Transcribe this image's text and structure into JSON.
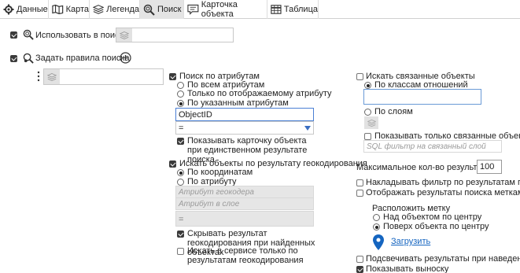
{
  "tabs": [
    {
      "label": "Данные",
      "icon": "gear-icon"
    },
    {
      "label": "Карта",
      "icon": "map-icon"
    },
    {
      "label": "Легенда",
      "icon": "layers-icon"
    },
    {
      "label": "Поиск",
      "icon": "search-icon",
      "active": true
    },
    {
      "label": "Карточка объекта",
      "icon": "card-icon"
    },
    {
      "label": "Таблица",
      "icon": "table-icon"
    }
  ],
  "use_in_search": "Использовать в поиске",
  "set_rules": "Задать правила поиска",
  "attr": {
    "title": "Поиск по атрибутам",
    "all": "По всем атрибутам",
    "display_only": "Только по отображаемому атрибуту",
    "specified": "По указанным атрибутам",
    "attribute_value": "ObjectID",
    "operator": "=",
    "show_card": "Показывать карточку объекта при единственном результате поиска"
  },
  "geo": {
    "title": "Искать объекты по результату геокодирования",
    "by_coords": "По координатам",
    "by_attr": "По атрибуту",
    "geocoder_placeholder": "Атрибут геокодера",
    "layer_placeholder": "Атрибут в слое",
    "operator": "=",
    "hide_result": "Скрывать результат геокодирования при найденных объектах",
    "search_service": "Искать в сервисе только по результатам геокодирования"
  },
  "related": {
    "title": "Искать связанные объекты",
    "by_classes": "По классам отношений",
    "by_layers": "По слоям",
    "show_only": "Показывать только связанные объекты",
    "sql_placeholder": "SQL фильтр на связанный слой"
  },
  "max_label": "Максимальное кол-во результатов",
  "max_value": "100",
  "apply_filter": "Накладывать фильтр по результатам поиска",
  "show_marks": "Отображать результаты поиска метками",
  "place_mark": "Расположить метку",
  "above": "Над объектом по центру",
  "over": "Поверх объекта по центру",
  "upload": "Загрузить",
  "highlight": "Подсвечивать результаты при наведении",
  "show_callout": "Показывать выноску",
  "accent": "#1565c0"
}
